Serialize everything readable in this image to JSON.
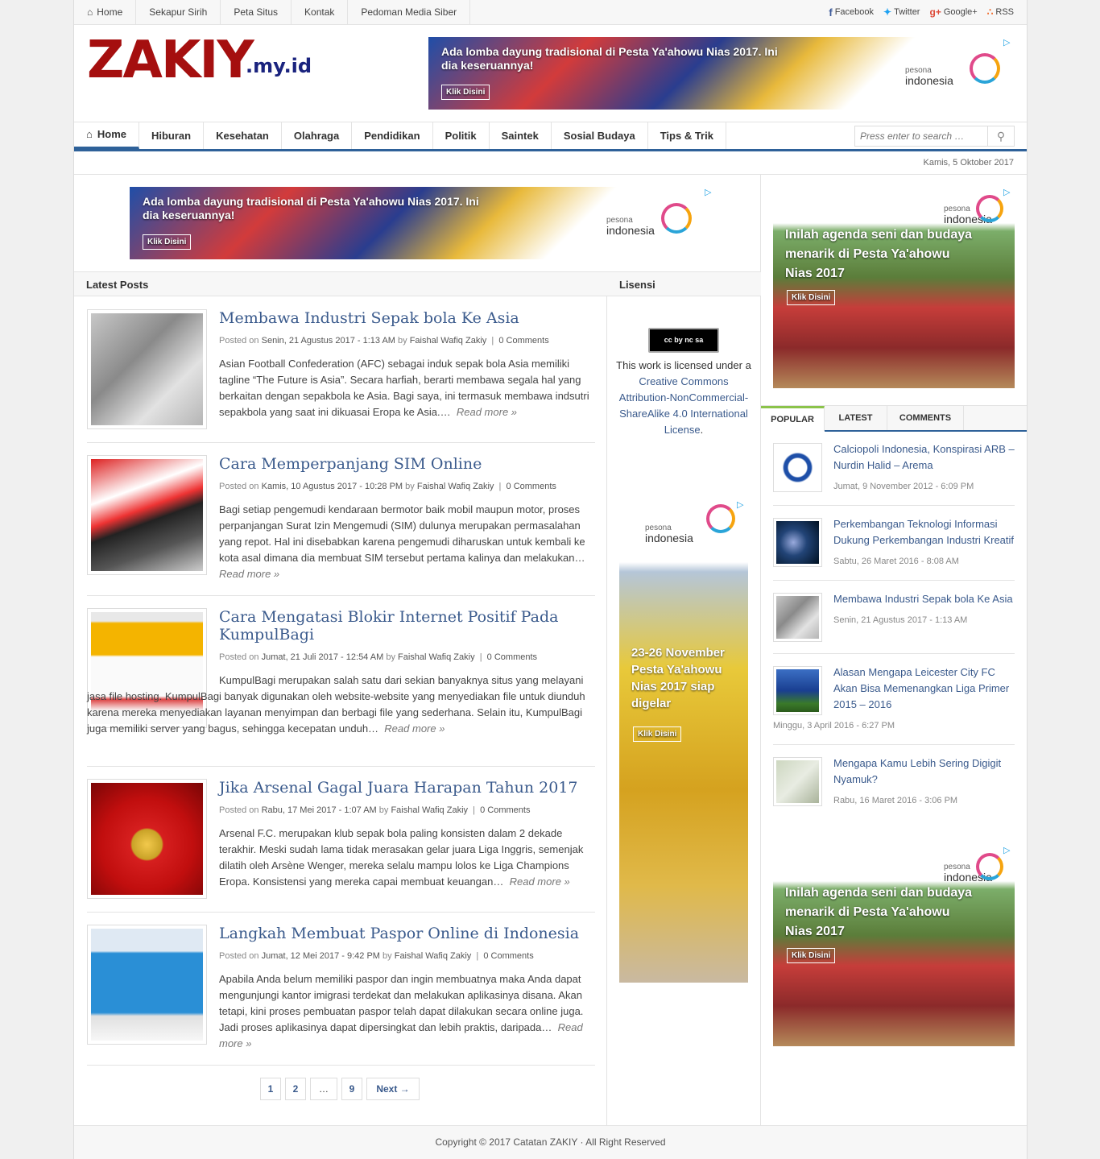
{
  "topbar": {
    "links": [
      "Home",
      "Sekapur Sirih",
      "Peta Situs",
      "Kontak",
      "Pedoman Media Siber"
    ],
    "social": [
      "Facebook",
      "Twitter",
      "Google+",
      "RSS"
    ]
  },
  "site": {
    "logo_main": "ZAKIY",
    "logo_sub": ".my.id"
  },
  "ads": {
    "wide_text": "Ada lomba dayung tradisional di Pesta Ya'ahowu Nias 2017. Ini dia keseruannya!",
    "button": "Klik Disini",
    "pesona_small": "pesona",
    "pesona_big": "indonesia",
    "square_text": "Inilah agenda seni dan budaya menarik di Pesta Ya'ahowu Nias 2017",
    "tall_text": "23-26 November Pesta Ya'ahowu Nias 2017 siap digelar"
  },
  "nav": {
    "items": [
      "Home",
      "Hiburan",
      "Kesehatan",
      "Olahraga",
      "Pendidikan",
      "Politik",
      "Saintek",
      "Sosial Budaya",
      "Tips & Trik"
    ],
    "search_placeholder": "Press enter to search …"
  },
  "date": "Kamis, 5 Oktober 2017",
  "sections": {
    "latest": "Latest Posts",
    "license": "Lisensi"
  },
  "posts": [
    {
      "title": "Membawa Industri Sepak bola Ke Asia",
      "date": "Senin, 21 Agustus 2017 - 1:13 AM",
      "author": "Faishal Wafiq Zakiy",
      "comments": "0 Comments",
      "excerpt": "Asian Football Confederation (AFC) sebagai induk sepak bola Asia memiliki tagline “The Future is Asia”. Secara harfiah, berarti membawa segala hal yang berkaitan dengan sepakbola ke Asia. Bagi saya, ini termasuk membawa indsutri sepakbola yang saat ini dikuasai Eropa ke Asia.…"
    },
    {
      "title": "Cara Memperpanjang SIM Online",
      "date": "Kamis, 10 Agustus 2017 - 10:28 PM",
      "author": "Faishal Wafiq Zakiy",
      "comments": "0 Comments",
      "excerpt": "Bagi setiap pengemudi kendaraan bermotor baik mobil maupun motor, proses perpanjangan Surat Izin Mengemudi (SIM) dulunya merupakan permasalahan yang repot. Hal ini disebabkan karena pengemudi diharuskan untuk kembali ke kota asal dimana dia membuat SIM tersebut pertama kalinya dan melakukan…"
    },
    {
      "title": "Cara Mengatasi Blokir Internet Positif Pada KumpulBagi",
      "date": "Jumat, 21 Juli 2017 - 12:54 AM",
      "author": "Faishal Wafiq Zakiy",
      "comments": "0 Comments",
      "excerpt": "KumpulBagi merupakan salah satu dari sekian banyaknya situs yang melayani jasa file hosting. KumpulBagi banyak digunakan oleh website-website yang menyediakan file untuk diunduh karena mereka menyediakan layanan menyimpan dan berbagi file yang sederhana. Selain itu, KumpulBagi juga memiliki server yang bagus, sehingga kecepatan unduh…"
    },
    {
      "title": "Jika Arsenal Gagal Juara Harapan Tahun 2017",
      "date": "Rabu, 17 Mei 2017 - 1:07 AM",
      "author": "Faishal Wafiq Zakiy",
      "comments": "0 Comments",
      "excerpt": "Arsenal F.C. merupakan klub sepak bola paling konsisten dalam 2 dekade terakhir. Meski sudah lama tidak merasakan gelar juara Liga Inggris, semenjak dilatih oleh Arsène Wenger, mereka selalu mampu lolos ke Liga Champions Eropa. Konsistensi yang mereka capai membuat keuangan…"
    },
    {
      "title": "Langkah Membuat Paspor Online di Indonesia",
      "date": "Jumat, 12 Mei 2017 - 9:42 PM",
      "author": "Faishal Wafiq Zakiy",
      "comments": "0 Comments",
      "excerpt": "Apabila Anda belum memiliki paspor dan ingin membuatnya maka Anda dapat mengunjungi kantor imigrasi terdekat dan melakukan aplikasinya disana. Akan tetapi, kini proses pembuatan paspor telah dapat dilakukan secara online juga. Jadi proses aplikasinya dapat dipersingkat dan lebih praktis, daripada…"
    }
  ],
  "labels": {
    "posted_on": "Posted on",
    "by": "by",
    "read_more": "Read more »"
  },
  "pagination": [
    "1",
    "2",
    "…",
    "9",
    "Next →"
  ],
  "license": {
    "badge": "cc by nc sa",
    "text_pre": "This work is licensed under a",
    "link": "Creative Commons Attribution-NonCommercial-ShareAlike 4.0 International License",
    "text_post": "."
  },
  "tabs": [
    "POPULAR",
    "LATEST",
    "COMMENTS"
  ],
  "popular": [
    {
      "title": "Calciopoli Indonesia, Konspirasi ARB – Nurdin Halid – Arema",
      "date": "Jumat, 9 November 2012 - 6:09 PM"
    },
    {
      "title": "Perkembangan Teknologi Informasi Dukung Perkembangan Industri Kreatif",
      "date": "Sabtu, 26 Maret 2016 - 8:08 AM"
    },
    {
      "title": "Membawa Industri Sepak bola Ke Asia",
      "date": "Senin, 21 Agustus 2017 - 1:13 AM"
    },
    {
      "title": "Alasan Mengapa Leicester City FC Akan Bisa Memenangkan Liga Primer 2015 – 2016",
      "date": "Minggu, 3 April 2016 - 6:27 PM"
    },
    {
      "title": "Mengapa Kamu Lebih Sering Digigit Nyamuk?",
      "date": "Rabu, 16 Maret 2016 - 3:06 PM"
    }
  ],
  "footer": "Copyright © 2017 Catatan ZAKIY · All Right Reserved"
}
